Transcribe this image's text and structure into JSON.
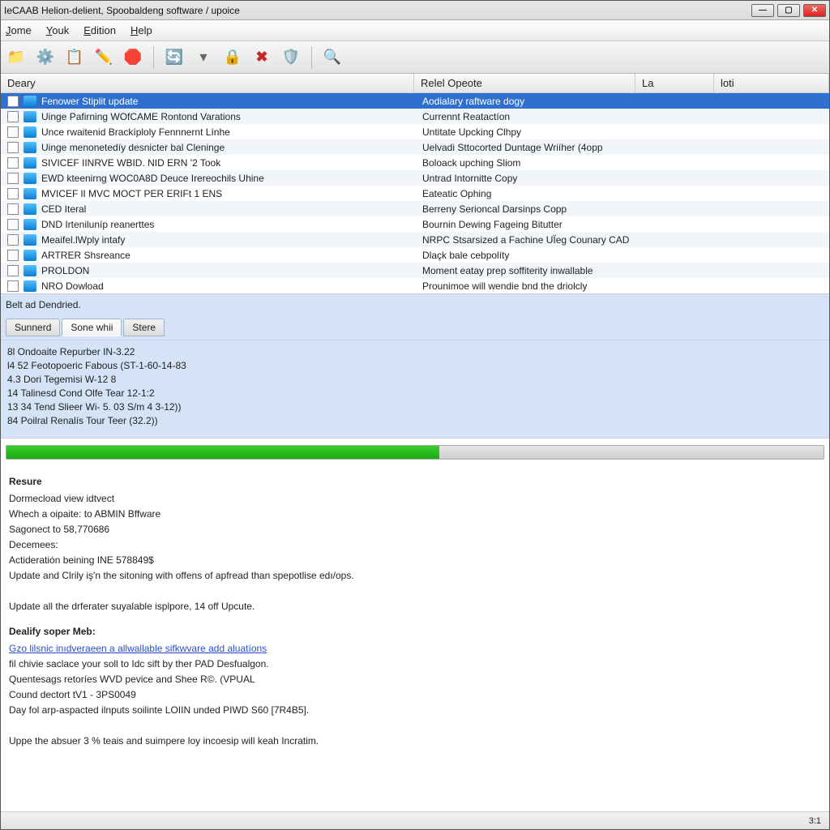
{
  "window": {
    "title": "IeCAAB Helion-delient, Spoobaldeng software / upoice"
  },
  "menu": {
    "items": [
      {
        "pre": "",
        "ul": "J",
        "post": "ome"
      },
      {
        "pre": "",
        "ul": "Y",
        "post": "ouk"
      },
      {
        "pre": "",
        "ul": "E",
        "post": "dition"
      },
      {
        "pre": "",
        "ul": "H",
        "post": "elp"
      }
    ]
  },
  "columns": {
    "deary": "Deary",
    "rel": "Relel Opeote",
    "la": "La",
    "loti": "loti"
  },
  "rows": [
    {
      "c1": "Fenower Stiplit update",
      "c2": "Aodialary raftware dogy",
      "sel": true
    },
    {
      "c1": "Uinge Pafirning WOfCAME Rontond Varations",
      "c2": "Currennt Reatactíon"
    },
    {
      "c1": "Unce rwaitenid Brackíploly Fennnernt Línhe",
      "c2": "Untitate Upcking Clhpy"
    },
    {
      "c1": "Uinge menonetedíy desnicter bal Cleninge",
      "c2": "Uelvadi Sttocorted Duntage Wriíher (4opp"
    },
    {
      "c1": "SIVICEF IINRVE WBID. NID ERN '2 Took",
      "c2": "Boloack upching Sliom"
    },
    {
      "c1": "EWD kteenirng WOC0A8D Deuce Irereochils Uhine",
      "c2": "Untrad Intornitte Copy"
    },
    {
      "c1": "MVICEF lI MVC MOCT PER ERIFt 1 ENS",
      "c2": "Eateatic Ophing"
    },
    {
      "c1": "CED Iteral",
      "c2": "Berreny Serioncal Darsinps Copp"
    },
    {
      "c1": "DND Irteniluníp reanerttes",
      "c2": "Bournin Dewing Fageing Bitutter"
    },
    {
      "c1": "Meaifel.lWply intafy",
      "c2": "NRPC Stsarsized a Fachine UÏeg Counary CAD"
    },
    {
      "c1": "ARTRER Shsreance",
      "c2": "Dlaçk bale cebpolíty"
    },
    {
      "c1": "PROLDON",
      "c2": "Moment eatay prep soffiterity inwallable"
    },
    {
      "c1": "NRO Dowload",
      "c2": "Prounimoe will wendie bnd the driolcly"
    }
  ],
  "belt": {
    "text": "Belt ad Dendried.",
    "tabs": [
      "Sunnerd",
      "Sone whii",
      "Stere"
    ],
    "active_tab": 1
  },
  "log": [
    "8l Ondoaite Repurber IN-3.22",
    "l4 52 Feotopoeric Fabous (ST-1-60-14-83",
    "4.3 Dori Tegemisi W-12 8",
    "14 Talinesd Cond Olfe Tear 12-1:2",
    "13 34 Tend Slieer Wi- 5. 03 S/m 4 3-12))",
    "84 Poilral Renalís Tour Teer (32.2))"
  ],
  "progress": {
    "percent": 53
  },
  "resure": {
    "heading": "Resure",
    "lines": [
      "Dormecload view idtvect",
      "Whech a oipaite: to ABMIN Bffware",
      "Sagonect to 58,770686",
      "Decemees:",
      "Actideratión beining INE 578849$",
      "Update and Clrily iş'n the sitoning with offens of apfread than spepotlise edı/ops.",
      "",
      "Update all the drferater suyalable isplpore, 14 off Upcute."
    ],
    "subheading": "Dealify soper Meb:",
    "link": "Gzo lilsnic inıdveraeen a allwallable sifkwvare add aluatíons",
    "footer": [
      "fil chivie saclace your soll to Idc sift by ther PAD Desfualgon.",
      "Quentesags retoríes WVD pevice and Shee R©. (VPUAL",
      "Cound dectort tV1 - 3PS0049",
      "Day fol arp-aspacted ilnputs soilinte LOIIN unded PIWD S60 [7R4B5].",
      "",
      "Uppe the absuer 3 % teais and suimpere loy incoesip will keah Incratim."
    ]
  },
  "status": {
    "right": "3:1"
  }
}
